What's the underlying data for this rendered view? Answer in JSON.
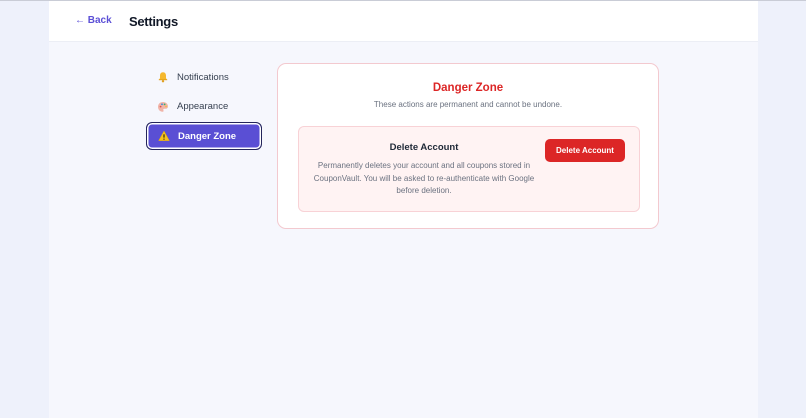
{
  "header": {
    "back_label": "← Back",
    "title": "Settings"
  },
  "sidebar": {
    "items": [
      {
        "label": "Notifications",
        "icon": "bell-icon",
        "active": false
      },
      {
        "label": "Appearance",
        "icon": "palette-icon",
        "active": false
      },
      {
        "label": "Danger Zone",
        "icon": "warning-icon",
        "active": true
      }
    ]
  },
  "danger_zone": {
    "title": "Danger Zone",
    "subtitle": "These actions are permanent and cannot be undone.",
    "delete_section": {
      "heading": "Delete Account",
      "description": "Permanently deletes your account and all coupons stored in CouponVault. You will be asked to re-authenticate with Google before deletion.",
      "button_label": "Delete Account"
    }
  },
  "colors": {
    "accent": "#5a4fd4",
    "danger": "#dc2626",
    "danger_bg": "#fff3f3",
    "page_bg": "#eef1fb"
  }
}
